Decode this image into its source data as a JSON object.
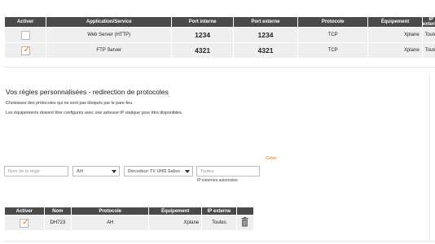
{
  "table1": {
    "headers": [
      "Activer",
      "Application/Service",
      "Port interne",
      "Port externe",
      "Protocole",
      "Équipement",
      "IP externe"
    ],
    "rows": [
      {
        "checked": false,
        "service": "Web Server (HTTP)",
        "port_int": "1234",
        "port_ext": "1234",
        "protocol": "TCP",
        "device": "Xplane",
        "ip": "Toutes"
      },
      {
        "checked": true,
        "service": "FTP Server",
        "port_int": "4321",
        "port_ext": "4321",
        "protocol": "TCP",
        "device": "Xplane",
        "ip": "Toutes"
      }
    ]
  },
  "section": {
    "title": "Vos règles personnalisées - redirection de protocoles",
    "line1": "Choisissez des protocoles qui ne sont pas bloqués par le pare-feu.",
    "line2": "Les équipements doivent être configurés avec une adresse IP statique pour être disponibles."
  },
  "form": {
    "create_label": "Créer",
    "rule_name_placeholder": "Nom de la règle",
    "protocol_value": "AH",
    "device_value": "Décodeur TV UHD Salon",
    "ip_placeholder": "Toutes",
    "ip_hint": "IP externes autorisées"
  },
  "table2": {
    "headers": [
      "Activer",
      "Nom",
      "Protocole",
      "Équipement",
      "IP externe"
    ],
    "rows": [
      {
        "checked": true,
        "name": "DH723",
        "protocol": "AH",
        "device": "Xplane",
        "ip": "Toutes"
      }
    ]
  },
  "colors": {
    "accent": "#f16e00",
    "header_bg": "#4a4a4a",
    "row_bg": "#efefef"
  }
}
